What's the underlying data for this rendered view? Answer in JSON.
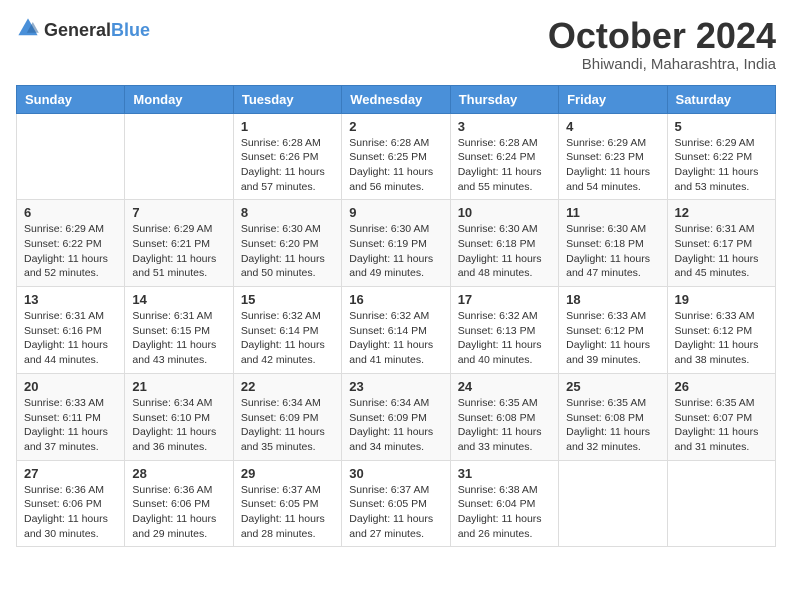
{
  "header": {
    "logo_general": "General",
    "logo_blue": "Blue",
    "month_title": "October 2024",
    "location": "Bhiwandi, Maharashtra, India"
  },
  "columns": [
    "Sunday",
    "Monday",
    "Tuesday",
    "Wednesday",
    "Thursday",
    "Friday",
    "Saturday"
  ],
  "weeks": [
    [
      {
        "day": "",
        "info": ""
      },
      {
        "day": "",
        "info": ""
      },
      {
        "day": "1",
        "info": "Sunrise: 6:28 AM\nSunset: 6:26 PM\nDaylight: 11 hours and 57 minutes."
      },
      {
        "day": "2",
        "info": "Sunrise: 6:28 AM\nSunset: 6:25 PM\nDaylight: 11 hours and 56 minutes."
      },
      {
        "day": "3",
        "info": "Sunrise: 6:28 AM\nSunset: 6:24 PM\nDaylight: 11 hours and 55 minutes."
      },
      {
        "day": "4",
        "info": "Sunrise: 6:29 AM\nSunset: 6:23 PM\nDaylight: 11 hours and 54 minutes."
      },
      {
        "day": "5",
        "info": "Sunrise: 6:29 AM\nSunset: 6:22 PM\nDaylight: 11 hours and 53 minutes."
      }
    ],
    [
      {
        "day": "6",
        "info": "Sunrise: 6:29 AM\nSunset: 6:22 PM\nDaylight: 11 hours and 52 minutes."
      },
      {
        "day": "7",
        "info": "Sunrise: 6:29 AM\nSunset: 6:21 PM\nDaylight: 11 hours and 51 minutes."
      },
      {
        "day": "8",
        "info": "Sunrise: 6:30 AM\nSunset: 6:20 PM\nDaylight: 11 hours and 50 minutes."
      },
      {
        "day": "9",
        "info": "Sunrise: 6:30 AM\nSunset: 6:19 PM\nDaylight: 11 hours and 49 minutes."
      },
      {
        "day": "10",
        "info": "Sunrise: 6:30 AM\nSunset: 6:18 PM\nDaylight: 11 hours and 48 minutes."
      },
      {
        "day": "11",
        "info": "Sunrise: 6:30 AM\nSunset: 6:18 PM\nDaylight: 11 hours and 47 minutes."
      },
      {
        "day": "12",
        "info": "Sunrise: 6:31 AM\nSunset: 6:17 PM\nDaylight: 11 hours and 45 minutes."
      }
    ],
    [
      {
        "day": "13",
        "info": "Sunrise: 6:31 AM\nSunset: 6:16 PM\nDaylight: 11 hours and 44 minutes."
      },
      {
        "day": "14",
        "info": "Sunrise: 6:31 AM\nSunset: 6:15 PM\nDaylight: 11 hours and 43 minutes."
      },
      {
        "day": "15",
        "info": "Sunrise: 6:32 AM\nSunset: 6:14 PM\nDaylight: 11 hours and 42 minutes."
      },
      {
        "day": "16",
        "info": "Sunrise: 6:32 AM\nSunset: 6:14 PM\nDaylight: 11 hours and 41 minutes."
      },
      {
        "day": "17",
        "info": "Sunrise: 6:32 AM\nSunset: 6:13 PM\nDaylight: 11 hours and 40 minutes."
      },
      {
        "day": "18",
        "info": "Sunrise: 6:33 AM\nSunset: 6:12 PM\nDaylight: 11 hours and 39 minutes."
      },
      {
        "day": "19",
        "info": "Sunrise: 6:33 AM\nSunset: 6:12 PM\nDaylight: 11 hours and 38 minutes."
      }
    ],
    [
      {
        "day": "20",
        "info": "Sunrise: 6:33 AM\nSunset: 6:11 PM\nDaylight: 11 hours and 37 minutes."
      },
      {
        "day": "21",
        "info": "Sunrise: 6:34 AM\nSunset: 6:10 PM\nDaylight: 11 hours and 36 minutes."
      },
      {
        "day": "22",
        "info": "Sunrise: 6:34 AM\nSunset: 6:09 PM\nDaylight: 11 hours and 35 minutes."
      },
      {
        "day": "23",
        "info": "Sunrise: 6:34 AM\nSunset: 6:09 PM\nDaylight: 11 hours and 34 minutes."
      },
      {
        "day": "24",
        "info": "Sunrise: 6:35 AM\nSunset: 6:08 PM\nDaylight: 11 hours and 33 minutes."
      },
      {
        "day": "25",
        "info": "Sunrise: 6:35 AM\nSunset: 6:08 PM\nDaylight: 11 hours and 32 minutes."
      },
      {
        "day": "26",
        "info": "Sunrise: 6:35 AM\nSunset: 6:07 PM\nDaylight: 11 hours and 31 minutes."
      }
    ],
    [
      {
        "day": "27",
        "info": "Sunrise: 6:36 AM\nSunset: 6:06 PM\nDaylight: 11 hours and 30 minutes."
      },
      {
        "day": "28",
        "info": "Sunrise: 6:36 AM\nSunset: 6:06 PM\nDaylight: 11 hours and 29 minutes."
      },
      {
        "day": "29",
        "info": "Sunrise: 6:37 AM\nSunset: 6:05 PM\nDaylight: 11 hours and 28 minutes."
      },
      {
        "day": "30",
        "info": "Sunrise: 6:37 AM\nSunset: 6:05 PM\nDaylight: 11 hours and 27 minutes."
      },
      {
        "day": "31",
        "info": "Sunrise: 6:38 AM\nSunset: 6:04 PM\nDaylight: 11 hours and 26 minutes."
      },
      {
        "day": "",
        "info": ""
      },
      {
        "day": "",
        "info": ""
      }
    ]
  ]
}
